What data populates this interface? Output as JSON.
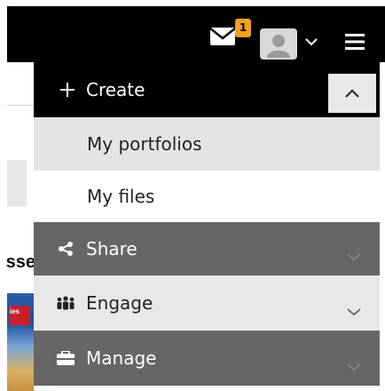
{
  "header": {
    "messages_badge": "1",
    "icons": {
      "mail": "envelope-icon",
      "avatar": "user-avatar",
      "user_menu": "chevron-down-icon",
      "main_menu": "hamburger-icon"
    }
  },
  "background": {
    "heading_fragment": "sse",
    "image_tag": "ies"
  },
  "menu": {
    "create": {
      "label": "Create",
      "icon": "plus-icon",
      "toggle_icon": "chevron-up-icon"
    },
    "create_items": [
      {
        "label": "My portfolios"
      },
      {
        "label": "My files"
      }
    ],
    "share": {
      "label": "Share",
      "icon": "share-icon",
      "toggle_icon": "chevron-down-icon"
    },
    "engage": {
      "label": "Engage",
      "icon": "people-group-icon",
      "toggle_icon": "chevron-down-icon"
    },
    "manage": {
      "label": "Manage",
      "icon": "briefcase-icon",
      "toggle_icon": "chevron-down-icon"
    }
  },
  "colors": {
    "header_bg": "#000000",
    "badge": "#f0a020",
    "section_dark": "#666666",
    "submenu_active": "#e4e4e4"
  }
}
